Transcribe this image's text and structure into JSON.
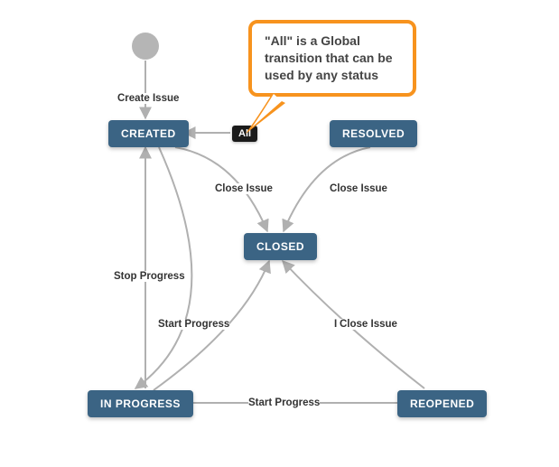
{
  "diagram": {
    "start_label": "Create Issue",
    "nodes": {
      "created": "CREATED",
      "resolved": "RESOLVED",
      "closed": "CLOSED",
      "in_progress": "IN PROGRESS",
      "reopened": "REOPENED",
      "all": "All"
    },
    "edges": {
      "close_issue_1": "Close Issue",
      "close_issue_2": "Close Issue",
      "close_issue_3": "Close Issue",
      "stop_progress": "Stop Progress",
      "start_progress_1": "Start Progress",
      "start_progress_2": "Start Progress",
      "resolve_divider": "I"
    },
    "callout_text": "\"All\" is a Global transition that can be used by any status"
  }
}
